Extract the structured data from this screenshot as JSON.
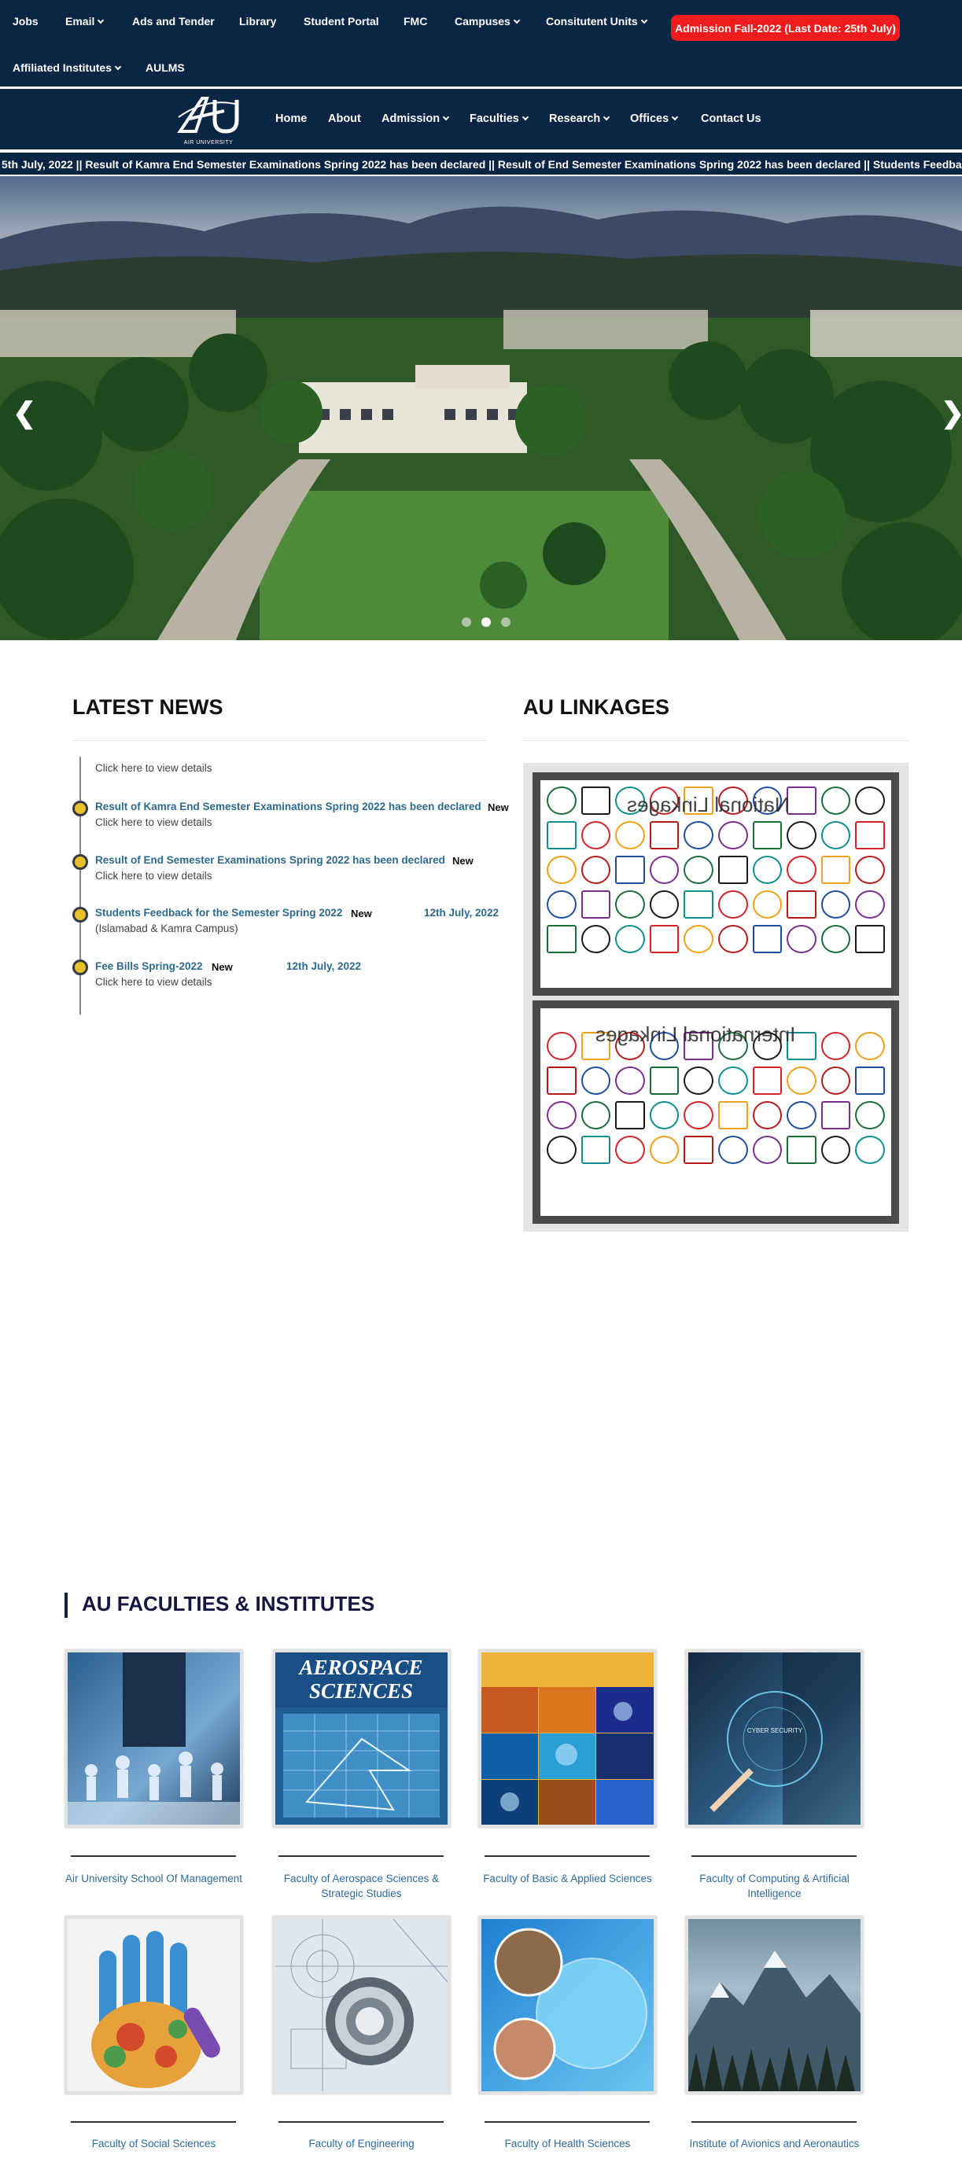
{
  "topnav": {
    "items": [
      {
        "label": "Jobs",
        "dropdown": false
      },
      {
        "label": "Email",
        "dropdown": true
      },
      {
        "label": "Ads and Tender",
        "dropdown": false
      },
      {
        "label": "Library",
        "dropdown": false
      },
      {
        "label": "Student Portal",
        "dropdown": false
      },
      {
        "label": "FMC",
        "dropdown": false
      },
      {
        "label": "Campuses",
        "dropdown": true
      },
      {
        "label": "Consitutent Units",
        "dropdown": true
      },
      {
        "label": "Affiliated Institutes",
        "dropdown": true
      },
      {
        "label": "AULMS",
        "dropdown": false
      }
    ],
    "admission_button": "Admission Fall-2022 (Last Date: 25th July)"
  },
  "mainnav": {
    "logo_text": "AIR UNIVERSITY",
    "items": [
      {
        "label": "Home",
        "dropdown": false
      },
      {
        "label": "About",
        "dropdown": false
      },
      {
        "label": "Admission",
        "dropdown": true
      },
      {
        "label": "Faculties",
        "dropdown": true
      },
      {
        "label": "Research",
        "dropdown": true
      },
      {
        "label": "Offices",
        "dropdown": true
      },
      {
        "label": "Contact Us",
        "dropdown": false
      }
    ]
  },
  "ticker": "5th July, 2022 || Result of Kamra End Semester Examinations Spring 2022 has been declared || Result of End Semester Examinations Spring 2022 has been declared || Students Feedback Spring",
  "hero": {
    "prev": "❮",
    "next": "❯",
    "slides": 3,
    "active_slide": 2
  },
  "news": {
    "title": "LATEST NEWS",
    "top_sub": "Click here to view details",
    "items": [
      {
        "title": "Result of Kamra End Semester Examinations Spring 2022 has been declared",
        "badge": "New",
        "date": "",
        "sub": "Click here to view details"
      },
      {
        "title": "Result of End Semester Examinations Spring 2022 has been declared",
        "badge": "New",
        "date": "",
        "sub": "Click here to view details"
      },
      {
        "title": "Students Feedback for the Semester Spring 2022",
        "badge": "New",
        "date": "12th July, 2022",
        "sub": "(Islamabad & Kamra Campus)"
      },
      {
        "title": "Fee Bills Spring-2022",
        "badge": "New",
        "date": "12th July, 2022",
        "sub": "Click here to view details"
      }
    ]
  },
  "linkages": {
    "title": "AU LINKAGES",
    "national_caption": "National Linkages",
    "international_caption": "International Linkages",
    "logo_colors": [
      "#1c6d3a",
      "#d4232a",
      "#1f4e9c",
      "#1a1a1a",
      "#f0a11c",
      "#7a2f8c",
      "#0f8f8f",
      "#b71c1c"
    ]
  },
  "faculties": {
    "title": "AU FACULTIES & INSTITUTES",
    "cards": [
      {
        "label": "Air University School Of Management",
        "image": "business-people-image"
      },
      {
        "label": "Faculty of Aerospace Sciences & Strategic Studies",
        "image": "aerospace-sciences-image",
        "image_text": "AEROSPACE SCIENCES"
      },
      {
        "label": "Faculty of Basic & Applied Sciences",
        "image": "science-grid-image"
      },
      {
        "label": "Faculty of Computing & Artificial Intelligence",
        "image": "cyber-security-image",
        "image_text": "CYBER SECURITY"
      },
      {
        "label": "Faculty of Social Sciences",
        "image": "painted-hand-image"
      },
      {
        "label": "Faculty of Engineering",
        "image": "bearing-drawing-image"
      },
      {
        "label": "Faculty of Health Sciences",
        "image": "medical-cells-image"
      },
      {
        "label": "Institute of Avionics and Aeronautics",
        "image": "mountains-image"
      }
    ]
  }
}
